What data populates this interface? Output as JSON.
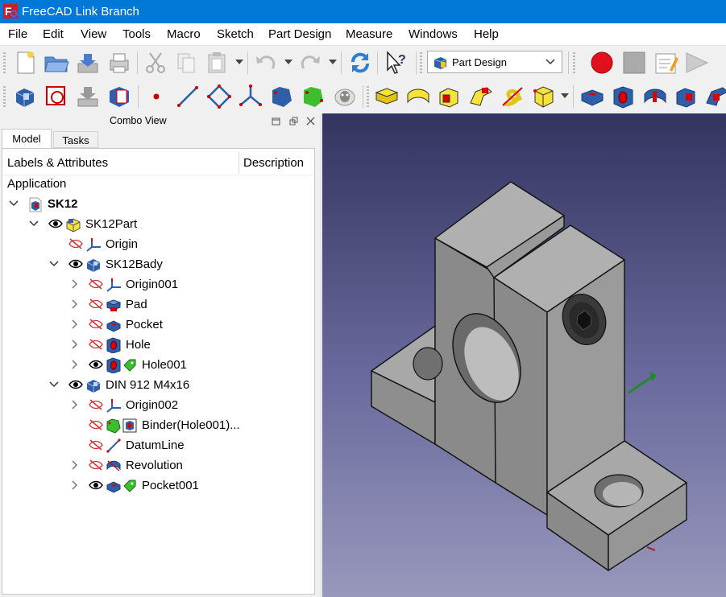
{
  "window": {
    "title": "FreeCAD Link Branch"
  },
  "menubar": {
    "items": [
      "File",
      "Edit",
      "View",
      "Tools",
      "Macro",
      "Sketch",
      "Part Design",
      "Measure",
      "Windows",
      "Help"
    ]
  },
  "toolbar": {
    "workbench": "Part Design"
  },
  "combo_view": {
    "title": "Combo View",
    "tabs": [
      "Model",
      "Tasks"
    ]
  },
  "tree": {
    "columns": [
      "Labels & Attributes",
      "Description"
    ],
    "root_label": "Application",
    "items": [
      {
        "label": "SK12",
        "bold": true
      },
      {
        "label": "SK12Part"
      },
      {
        "label": "Origin"
      },
      {
        "label": "SK12Bady"
      },
      {
        "label": "Origin001"
      },
      {
        "label": "Pad"
      },
      {
        "label": "Pocket"
      },
      {
        "label": "Hole"
      },
      {
        "label": "Hole001"
      },
      {
        "label": "DIN 912 M4x16"
      },
      {
        "label": "Origin002"
      },
      {
        "label": "Binder(Hole001)..."
      },
      {
        "label": "DatumLine"
      },
      {
        "label": "Revolution"
      },
      {
        "label": "Pocket001"
      }
    ]
  },
  "colors": {
    "titlebar": "#0078d7",
    "viewport_top": "#343460",
    "viewport_bottom": "#9898bc",
    "model_face": "#9a9a9a"
  }
}
